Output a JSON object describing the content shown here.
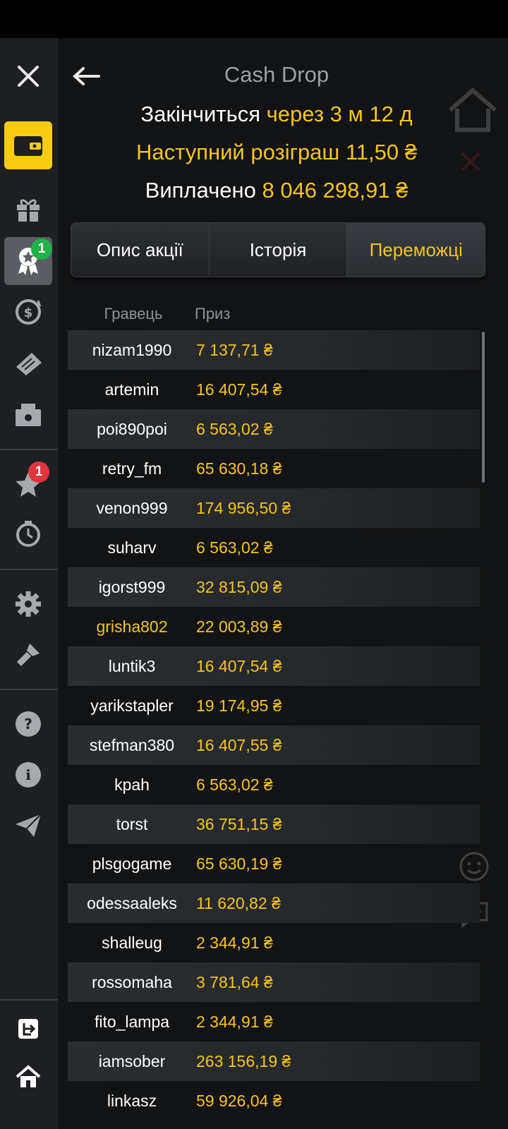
{
  "header": {
    "title": "Cash Drop",
    "ends_label": "Закінчиться",
    "ends_value": "через 3 м 12 д",
    "next_draw": "Наступний розіграш 11,50 ₴",
    "paid_label": "Виплачено",
    "paid_value": "8 046 298,91 ₴"
  },
  "tabs": [
    {
      "label": "Опис акції",
      "active": false
    },
    {
      "label": "Історія",
      "active": false
    },
    {
      "label": "Переможці",
      "active": true
    }
  ],
  "table": {
    "headers": {
      "player": "Гравець",
      "prize": "Приз"
    },
    "rows": [
      {
        "player": "nizam1990",
        "prize": "7 137,71 ₴"
      },
      {
        "player": "artemin",
        "prize": "16 407,54 ₴"
      },
      {
        "player": "poi890poi",
        "prize": "6 563,02 ₴"
      },
      {
        "player": "retry_fm",
        "prize": "65 630,18 ₴"
      },
      {
        "player": "venon999",
        "prize": "174 956,50 ₴"
      },
      {
        "player": "suharv",
        "prize": "6 563,02 ₴"
      },
      {
        "player": "igorst999",
        "prize": "32 815,09 ₴"
      },
      {
        "player": "grisha802",
        "prize": "22 003,89 ₴"
      },
      {
        "player": "luntik3",
        "prize": "16 407,54 ₴"
      },
      {
        "player": "yarikstapler",
        "prize": "19 174,95 ₴"
      },
      {
        "player": "stefman380",
        "prize": "16 407,55 ₴"
      },
      {
        "player": "kpah",
        "prize": "6 563,02 ₴"
      },
      {
        "player": "torst",
        "prize": "36 751,15 ₴"
      },
      {
        "player": "plsgogame",
        "prize": "65 630,19 ₴"
      },
      {
        "player": "odessaaleks",
        "prize": "11 620,82 ₴"
      },
      {
        "player": "shalleug",
        "prize": "2 344,91 ₴"
      },
      {
        "player": "rossomaha",
        "prize": "3 781,64 ₴"
      },
      {
        "player": "fito_lampa",
        "prize": "2 344,91 ₴"
      },
      {
        "player": "iamsober",
        "prize": "263 156,19 ₴"
      },
      {
        "player": "linkasz",
        "prize": "59 926,04 ₴"
      }
    ]
  },
  "sidebar": {
    "badges": {
      "rewards": "1",
      "favorites": "1"
    },
    "icons": [
      "close-icon",
      "wallet-icon",
      "gift-icon",
      "award-icon",
      "cashback-icon",
      "ticket-icon",
      "cashier-icon",
      "star-icon",
      "timer-icon",
      "settings-icon",
      "brush-icon",
      "help-icon",
      "info-icon",
      "send-icon",
      "logout-icon",
      "home-icon"
    ]
  },
  "colors": {
    "accent": "#f5c518",
    "sidebar_bg": "#1d1f22",
    "main_bg": "#121314",
    "badge_green": "#21b04a",
    "badge_red": "#e0353f"
  }
}
